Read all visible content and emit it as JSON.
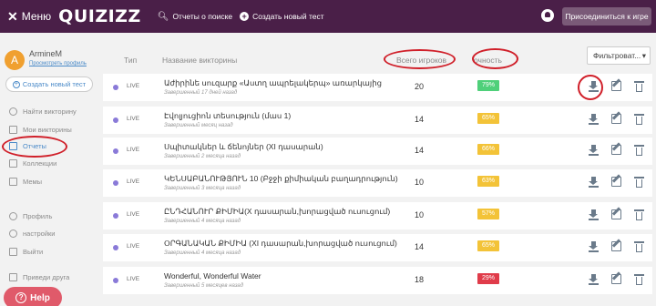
{
  "topbar": {
    "menu_label": "Меню",
    "logo": "QUIZIZZ",
    "search_reports": "Отчеты о поиске",
    "create_test": "Создать новый тест",
    "join_game": "Присоединиться к игре"
  },
  "sidebar": {
    "avatar_letter": "A",
    "username": "ArmineM",
    "view_profile": "Просмотреть профиль",
    "new_test": "Создать новый тест",
    "items": [
      {
        "label": "Найти викторину"
      },
      {
        "label": "Мои викторины"
      },
      {
        "label": "Отчеты"
      },
      {
        "label": "Коллекции"
      },
      {
        "label": "Мемы"
      },
      {
        "label": "Профиль"
      },
      {
        "label": "настройки"
      },
      {
        "label": "Выйти"
      },
      {
        "label": "Приведи друга"
      }
    ],
    "help": "Help"
  },
  "table": {
    "headers": {
      "type": "Тип",
      "name": "Название викторины",
      "players": "Всего игроков",
      "accuracy": "очность"
    },
    "filter_label": "Фильтроват...",
    "rows": [
      {
        "status": "LIVE",
        "title": "Աժիրինե սուզարք «Աստղ ապրելակերպ» առարկայից",
        "sub": "Завершенный 17 дней назад",
        "players": "20",
        "accuracy": "79%",
        "acc_color": "#4fd07a"
      },
      {
        "status": "LIVE",
        "title": "Էվոլյուցիոն տեսություն (մաս 1)",
        "sub": "Завершенный месяц назад",
        "players": "14",
        "accuracy": "65%",
        "acc_color": "#f3c338"
      },
      {
        "status": "LIVE",
        "title": "Սպիտակներ և ճենոյներ (XI դասարան)",
        "sub": "Завершенный 2 месяца назад",
        "players": "14",
        "accuracy": "66%",
        "acc_color": "#f3c338"
      },
      {
        "status": "LIVE",
        "title": "ԿԵՆՍԱԲԱՆՈՒԹՅՈՒՆ 10 (Բջջի քիմիական բաղադրություն)",
        "sub": "Завершенный 3 месяца назад",
        "players": "10",
        "accuracy": "63%",
        "acc_color": "#f3c338"
      },
      {
        "status": "LIVE",
        "title": "ԸՆԴՀԱՆՈՒՐ ՔԻՄԻԱ(X դասարան,խորացված ուսուցում)",
        "sub": "Завершенный 4 месяца назад",
        "players": "10",
        "accuracy": "57%",
        "acc_color": "#f3c338"
      },
      {
        "status": "LIVE",
        "title": "ՕՐԳԱՆԱԿԱՆ ՔԻՄԻԱ (XI դասարան,խորացված ուսուցում)",
        "sub": "Завершенный 4 месяца назад",
        "players": "14",
        "accuracy": "65%",
        "acc_color": "#f3c338"
      },
      {
        "status": "LIVE",
        "title": "Wonderful, Wonderful Water",
        "sub": "Завершенный 5 месяцев назад",
        "players": "18",
        "accuracy": "29%",
        "acc_color": "#e03c4a"
      }
    ]
  },
  "colors": {
    "topbar": "#4a1f48",
    "accent": "#4a8ac8",
    "annotation_red": "#d0202a"
  }
}
